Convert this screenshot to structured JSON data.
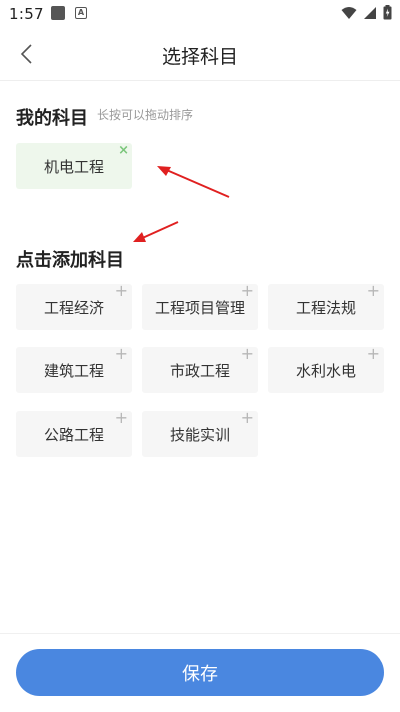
{
  "status": {
    "time": "1:57",
    "a_label": "A"
  },
  "nav": {
    "title": "选择科目"
  },
  "my_subjects": {
    "title": "我的科目",
    "hint": "长按可以拖动排序",
    "items": [
      {
        "label": "机电工程",
        "remove_symbol": "×"
      }
    ]
  },
  "add_subjects": {
    "title": "点击添加科目",
    "add_symbol": "+",
    "items": [
      {
        "label": "工程经济"
      },
      {
        "label": "工程项目管理"
      },
      {
        "label": "工程法规"
      },
      {
        "label": "建筑工程"
      },
      {
        "label": "市政工程"
      },
      {
        "label": "水利水电"
      },
      {
        "label": "公路工程"
      },
      {
        "label": "技能实训"
      }
    ]
  },
  "save_button": {
    "label": "保存"
  },
  "colors": {
    "accent": "#4a87e0",
    "selected_chip": "#eef7ec",
    "remove_x": "#7bc67b",
    "annotation_arrow": "#e02020"
  }
}
